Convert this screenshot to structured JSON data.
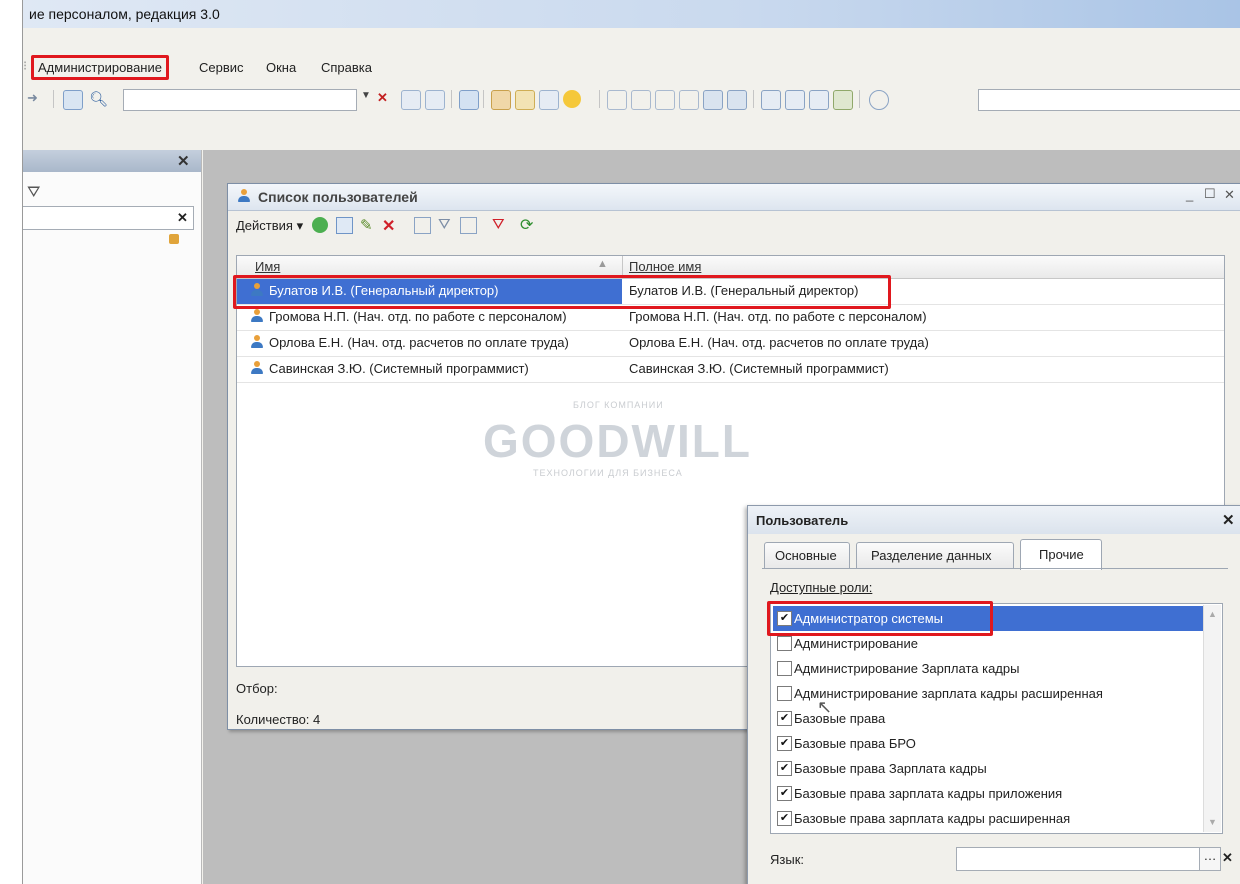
{
  "window": {
    "title": "ие персоналом, редакция 3.0"
  },
  "menu": {
    "items": [
      "Администрирование",
      "Сервис",
      "Окна",
      "Справка"
    ]
  },
  "users_window": {
    "title": "Список пользователей",
    "actions_label": "Действия ▾",
    "columns": [
      "Имя",
      "Полное имя"
    ],
    "rows": [
      {
        "name": "Булатов И.В. (Генеральный директор)",
        "full_name": "Булатов И.В. (Генеральный директор)",
        "selected": true
      },
      {
        "name": "Громова Н.П. (Нач. отд. по работе с персоналом)",
        "full_name": "Громова Н.П. (Нач. отд. по работе с персоналом)",
        "selected": false
      },
      {
        "name": "Орлова Е.Н. (Нач. отд. расчетов по оплате труда)",
        "full_name": "Орлова Е.Н. (Нач. отд. расчетов по оплате труда)",
        "selected": false
      },
      {
        "name": "Савинская З.Ю. (Системный программист)",
        "full_name": "Савинская З.Ю. (Системный программист)",
        "selected": false
      }
    ],
    "filter_label": "Отбор:",
    "count_label": "Количество: 4"
  },
  "watermark": {
    "top": "БЛОГ КОМПАНИИ",
    "brand": "GOODWILL",
    "bottom": "ТЕХНОЛОГИИ ДЛЯ БИЗНЕСА"
  },
  "user_dialog": {
    "title": "Пользователь",
    "tabs": [
      "Основные",
      "Разделение данных",
      "Прочие"
    ],
    "active_tab": "Прочие",
    "roles_label": "Доступные роли:",
    "roles": [
      {
        "label": "Администратор системы",
        "checked": true
      },
      {
        "label": "Администрирование",
        "checked": false
      },
      {
        "label": "Администрирование Зарплата кадры",
        "checked": false
      },
      {
        "label": "Администрирование зарплата кадры расширенная",
        "checked": false
      },
      {
        "label": "Базовые права",
        "checked": true
      },
      {
        "label": "Базовые права БРО",
        "checked": true
      },
      {
        "label": "Базовые права Зарплата кадры",
        "checked": true
      },
      {
        "label": "Базовые права зарплата кадры приложения",
        "checked": true
      },
      {
        "label": "Базовые права зарплата кадры расширенная",
        "checked": true
      }
    ],
    "language_label": "Язык:",
    "language_value": ""
  },
  "colors": {
    "highlight": "#e0181e",
    "selection": "#3f6fd2",
    "accent": "#3d79c3"
  }
}
